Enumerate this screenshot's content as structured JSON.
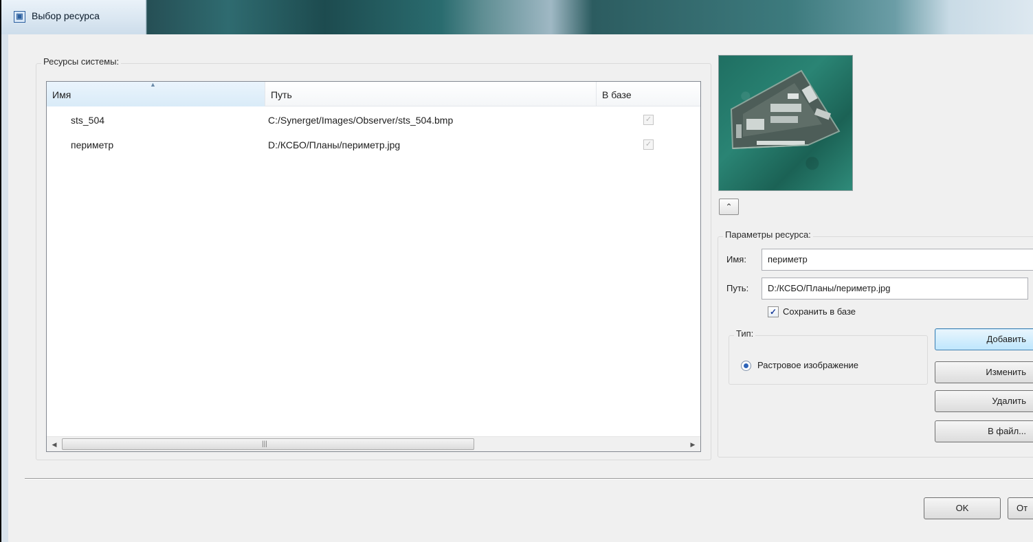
{
  "window": {
    "title": "Выбор ресурса"
  },
  "resources_group": {
    "title": "Ресурсы системы:",
    "columns": [
      "Имя",
      "Путь",
      "В базе"
    ],
    "rows": [
      {
        "name": "sts_504",
        "path": "C:/Synerget/Images/Observer/sts_504.bmp",
        "in_db": true
      },
      {
        "name": "периметр",
        "path": "D:/КСБО/Планы/периметр.jpg",
        "in_db": true
      }
    ],
    "scroll_left": "◀",
    "scroll_right": "▶",
    "scroll_grip": "|||"
  },
  "preview": {
    "collapse_glyph": "⌃"
  },
  "params_group": {
    "title": "Параметры ресурса:",
    "name_label": "Имя:",
    "name_value": "периметр",
    "path_label": "Путь:",
    "path_value": "D:/КСБО/Планы/периметр.jpg",
    "save_label": "Сохранить в базе",
    "save_checked": true,
    "type_title": "Тип:",
    "type_option": "Растровое изображение"
  },
  "buttons": {
    "add": "Добавить",
    "edit": "Изменить",
    "delete": "Удалить",
    "to_file": "В файл...",
    "ok": "OK",
    "cancel": "От"
  },
  "colors": {
    "accent": "#3c7fb1",
    "check": "#1c3f9c"
  }
}
